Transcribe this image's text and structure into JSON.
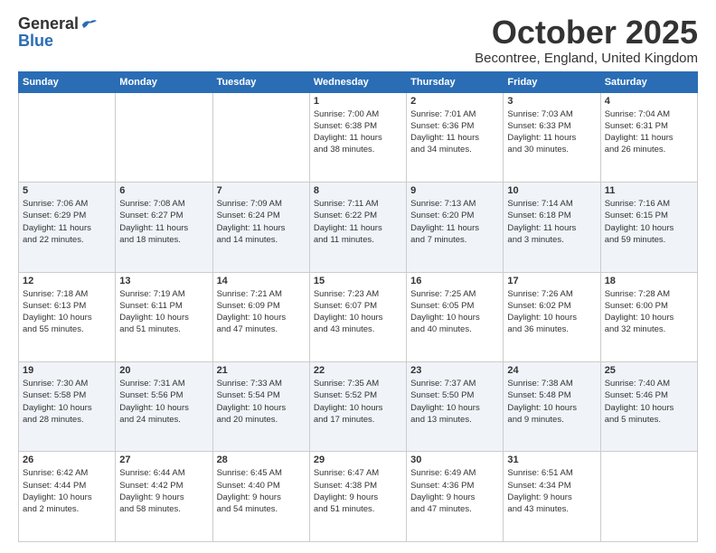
{
  "header": {
    "logo_general": "General",
    "logo_blue": "Blue",
    "month_title": "October 2025",
    "location": "Becontree, England, United Kingdom"
  },
  "days_of_week": [
    "Sunday",
    "Monday",
    "Tuesday",
    "Wednesday",
    "Thursday",
    "Friday",
    "Saturday"
  ],
  "weeks": [
    [
      {
        "day": "",
        "info": ""
      },
      {
        "day": "",
        "info": ""
      },
      {
        "day": "",
        "info": ""
      },
      {
        "day": "1",
        "info": "Sunrise: 7:00 AM\nSunset: 6:38 PM\nDaylight: 11 hours\nand 38 minutes."
      },
      {
        "day": "2",
        "info": "Sunrise: 7:01 AM\nSunset: 6:36 PM\nDaylight: 11 hours\nand 34 minutes."
      },
      {
        "day": "3",
        "info": "Sunrise: 7:03 AM\nSunset: 6:33 PM\nDaylight: 11 hours\nand 30 minutes."
      },
      {
        "day": "4",
        "info": "Sunrise: 7:04 AM\nSunset: 6:31 PM\nDaylight: 11 hours\nand 26 minutes."
      }
    ],
    [
      {
        "day": "5",
        "info": "Sunrise: 7:06 AM\nSunset: 6:29 PM\nDaylight: 11 hours\nand 22 minutes."
      },
      {
        "day": "6",
        "info": "Sunrise: 7:08 AM\nSunset: 6:27 PM\nDaylight: 11 hours\nand 18 minutes."
      },
      {
        "day": "7",
        "info": "Sunrise: 7:09 AM\nSunset: 6:24 PM\nDaylight: 11 hours\nand 14 minutes."
      },
      {
        "day": "8",
        "info": "Sunrise: 7:11 AM\nSunset: 6:22 PM\nDaylight: 11 hours\nand 11 minutes."
      },
      {
        "day": "9",
        "info": "Sunrise: 7:13 AM\nSunset: 6:20 PM\nDaylight: 11 hours\nand 7 minutes."
      },
      {
        "day": "10",
        "info": "Sunrise: 7:14 AM\nSunset: 6:18 PM\nDaylight: 11 hours\nand 3 minutes."
      },
      {
        "day": "11",
        "info": "Sunrise: 7:16 AM\nSunset: 6:15 PM\nDaylight: 10 hours\nand 59 minutes."
      }
    ],
    [
      {
        "day": "12",
        "info": "Sunrise: 7:18 AM\nSunset: 6:13 PM\nDaylight: 10 hours\nand 55 minutes."
      },
      {
        "day": "13",
        "info": "Sunrise: 7:19 AM\nSunset: 6:11 PM\nDaylight: 10 hours\nand 51 minutes."
      },
      {
        "day": "14",
        "info": "Sunrise: 7:21 AM\nSunset: 6:09 PM\nDaylight: 10 hours\nand 47 minutes."
      },
      {
        "day": "15",
        "info": "Sunrise: 7:23 AM\nSunset: 6:07 PM\nDaylight: 10 hours\nand 43 minutes."
      },
      {
        "day": "16",
        "info": "Sunrise: 7:25 AM\nSunset: 6:05 PM\nDaylight: 10 hours\nand 40 minutes."
      },
      {
        "day": "17",
        "info": "Sunrise: 7:26 AM\nSunset: 6:02 PM\nDaylight: 10 hours\nand 36 minutes."
      },
      {
        "day": "18",
        "info": "Sunrise: 7:28 AM\nSunset: 6:00 PM\nDaylight: 10 hours\nand 32 minutes."
      }
    ],
    [
      {
        "day": "19",
        "info": "Sunrise: 7:30 AM\nSunset: 5:58 PM\nDaylight: 10 hours\nand 28 minutes."
      },
      {
        "day": "20",
        "info": "Sunrise: 7:31 AM\nSunset: 5:56 PM\nDaylight: 10 hours\nand 24 minutes."
      },
      {
        "day": "21",
        "info": "Sunrise: 7:33 AM\nSunset: 5:54 PM\nDaylight: 10 hours\nand 20 minutes."
      },
      {
        "day": "22",
        "info": "Sunrise: 7:35 AM\nSunset: 5:52 PM\nDaylight: 10 hours\nand 17 minutes."
      },
      {
        "day": "23",
        "info": "Sunrise: 7:37 AM\nSunset: 5:50 PM\nDaylight: 10 hours\nand 13 minutes."
      },
      {
        "day": "24",
        "info": "Sunrise: 7:38 AM\nSunset: 5:48 PM\nDaylight: 10 hours\nand 9 minutes."
      },
      {
        "day": "25",
        "info": "Sunrise: 7:40 AM\nSunset: 5:46 PM\nDaylight: 10 hours\nand 5 minutes."
      }
    ],
    [
      {
        "day": "26",
        "info": "Sunrise: 6:42 AM\nSunset: 4:44 PM\nDaylight: 10 hours\nand 2 minutes."
      },
      {
        "day": "27",
        "info": "Sunrise: 6:44 AM\nSunset: 4:42 PM\nDaylight: 9 hours\nand 58 minutes."
      },
      {
        "day": "28",
        "info": "Sunrise: 6:45 AM\nSunset: 4:40 PM\nDaylight: 9 hours\nand 54 minutes."
      },
      {
        "day": "29",
        "info": "Sunrise: 6:47 AM\nSunset: 4:38 PM\nDaylight: 9 hours\nand 51 minutes."
      },
      {
        "day": "30",
        "info": "Sunrise: 6:49 AM\nSunset: 4:36 PM\nDaylight: 9 hours\nand 47 minutes."
      },
      {
        "day": "31",
        "info": "Sunrise: 6:51 AM\nSunset: 4:34 PM\nDaylight: 9 hours\nand 43 minutes."
      },
      {
        "day": "",
        "info": ""
      }
    ]
  ]
}
